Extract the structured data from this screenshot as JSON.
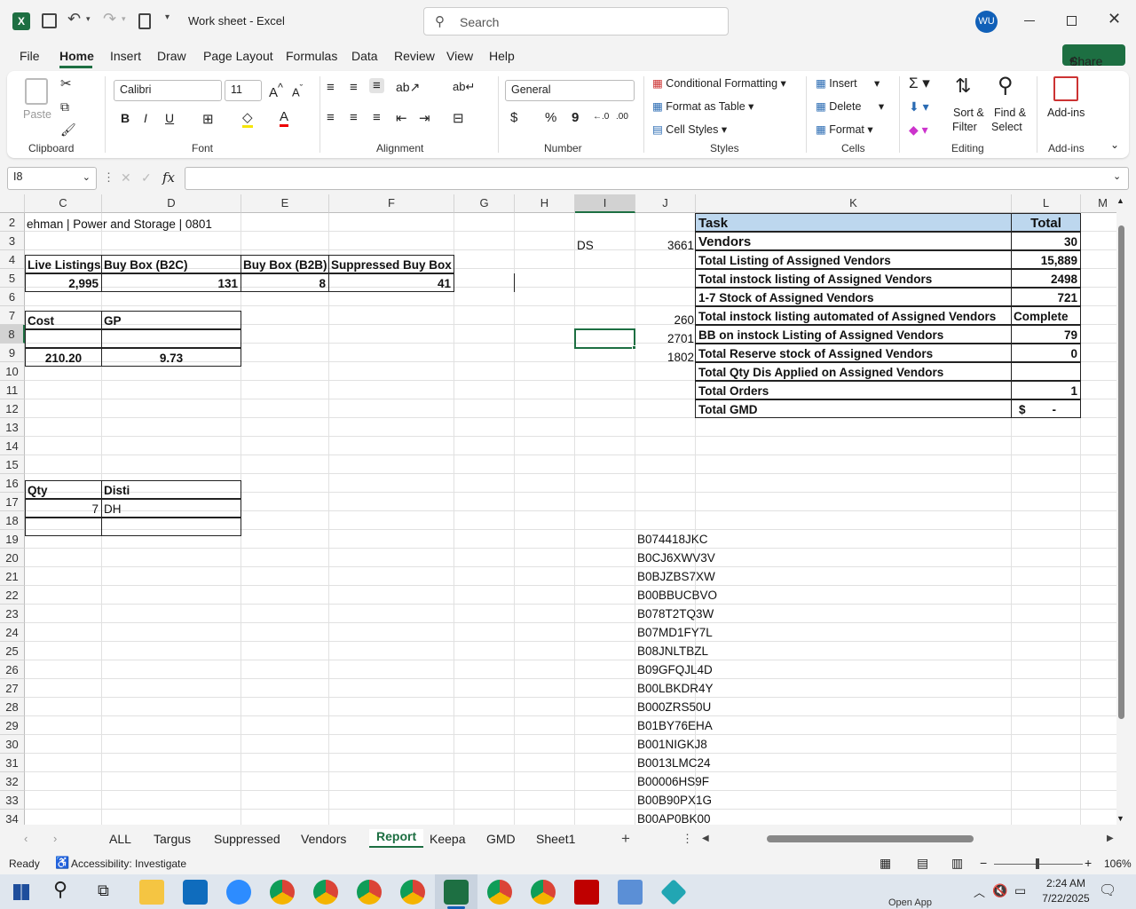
{
  "window": {
    "title": "Work sheet  -  Excel",
    "search_placeholder": "Search",
    "user_initials": "WU"
  },
  "menu": [
    "File",
    "Home",
    "Insert",
    "Draw",
    "Page Layout",
    "Formulas",
    "Data",
    "Review",
    "View",
    "Help"
  ],
  "share_label": "Share",
  "ribbon": {
    "paste": "Paste",
    "font_name": "Calibri",
    "font_size": "11",
    "number_format": "General",
    "conditional_formatting": "Conditional Formatting",
    "format_as_table": "Format as Table",
    "cell_styles": "Cell Styles",
    "insert": "Insert",
    "delete": "Delete",
    "format": "Format",
    "sort_filter_1": "Sort &",
    "sort_filter_2": "Filter",
    "find_select_1": "Find &",
    "find_select_2": "Select",
    "addins": "Add-ins",
    "groups": {
      "clipboard": "Clipboard",
      "font": "Font",
      "alignment": "Alignment",
      "number": "Number",
      "styles": "Styles",
      "cells": "Cells",
      "editing": "Editing",
      "addins": "Add-ins"
    }
  },
  "formula_bar": {
    "name_box": "I8",
    "fx": "fx",
    "content": ""
  },
  "columns": [
    "C",
    "D",
    "E",
    "F",
    "G",
    "H",
    "I",
    "J",
    "K",
    "L",
    "M"
  ],
  "rows": [
    "2",
    "3",
    "4",
    "5",
    "6",
    "7",
    "8",
    "9",
    "10",
    "11",
    "12",
    "13",
    "14",
    "15",
    "16",
    "17",
    "18",
    "19",
    "20",
    "21",
    "22",
    "23",
    "24",
    "25",
    "26",
    "27",
    "28",
    "29",
    "30",
    "31",
    "32",
    "33",
    "34"
  ],
  "cells": {
    "c2": "ehman | Power and Storage | 0801",
    "i3": "DS",
    "j3": "3661",
    "c4": "Live Listings",
    "d4": "Buy Box (B2C)",
    "e4": "Buy Box (B2B)",
    "f4": "Suppressed Buy Box",
    "c5": "2,995",
    "d5": "131",
    "e5": "8",
    "f5": "41",
    "c7": "Cost",
    "d7": "GP",
    "c9": "210.20",
    "d9": "9.73",
    "j7": "260",
    "j8": "2701",
    "j9": "1802",
    "c16": "Qty",
    "d16": "Disti",
    "c17": "7",
    "d17": "DH"
  },
  "task_table": {
    "header_task": "Task",
    "header_total": "Total",
    "rows": [
      {
        "task": "Vendors",
        "total": "30"
      },
      {
        "task": "Total Listing of Assigned Vendors",
        "total": "15,889"
      },
      {
        "task": "Total instock listing of Assigned Vendors",
        "total": "2498"
      },
      {
        "task": "1-7 Stock of Assigned Vendors",
        "total": "721"
      },
      {
        "task": "Total instock listing automated of Assigned Vendors",
        "total": "Complete"
      },
      {
        "task": "BB on instock Listing of Assigned Vendors",
        "total": "79"
      },
      {
        "task": "Total Reserve stock of Assigned Vendors",
        "total": "0"
      },
      {
        "task": "Total Qty Dis Applied on Assigned Vendors",
        "total": ""
      },
      {
        "task": "Total Orders",
        "total": "1"
      },
      {
        "task": "Total GMD",
        "total": "$        -"
      }
    ]
  },
  "asins": [
    "B074418JKC",
    "B0CJ6XWV3V",
    "B0BJZBS7XW",
    "B00BBUCBVO",
    "B078T2TQ3W",
    "B07MD1FY7L",
    "B08JNLTBZL",
    "B09GFQJL4D",
    "B00LBKDR4Y",
    "B000ZRS50U",
    "B01BY76EHA",
    "B001NIGKJ8",
    "B0013LMC24",
    "B00006HS9F",
    "B00B90PX1G",
    "B00AP0BK00"
  ],
  "sheet_tabs": [
    "ALL",
    "Targus",
    "Suppressed",
    "Vendors",
    "Report",
    "Keepa",
    "GMD",
    "Sheet1"
  ],
  "active_tab": "Report",
  "status": {
    "ready": "Ready",
    "accessibility": "Accessibility: Investigate",
    "zoom": "106%"
  },
  "taskbar": {
    "time": "2:24 AM",
    "date": "7/22/2025",
    "open_app": "Open App"
  }
}
